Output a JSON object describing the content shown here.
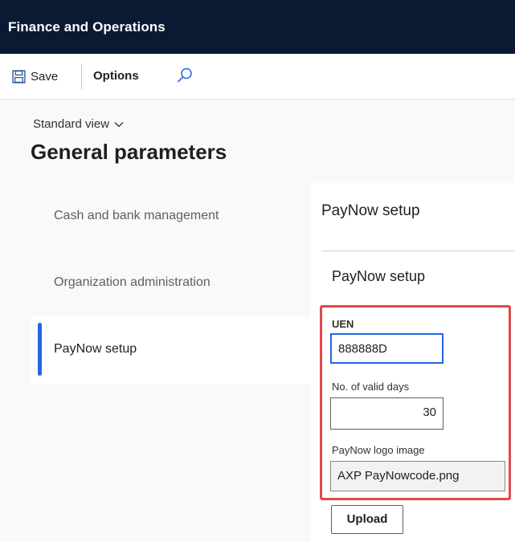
{
  "app": {
    "title": "Finance and Operations"
  },
  "toolbar": {
    "save_label": "Save",
    "options_label": "Options",
    "save_icon": "save-icon",
    "search_icon": "search-icon"
  },
  "header": {
    "view_label": "Standard view",
    "page_title": "General parameters"
  },
  "nav": {
    "items": [
      {
        "label": "Cash and bank management",
        "selected": false
      },
      {
        "label": "Organization administration",
        "selected": false
      },
      {
        "label": "PayNow setup",
        "selected": true
      }
    ]
  },
  "panel": {
    "title": "PayNow setup",
    "section_title": "PayNow setup",
    "fields": {
      "uen": {
        "label": "UEN",
        "value": "888888D"
      },
      "valid_days": {
        "label": "No. of valid days",
        "value": "30"
      },
      "logo": {
        "label": "PayNow logo image",
        "value": "AXP PayNowcode.png"
      }
    },
    "upload_label": "Upload"
  },
  "colors": {
    "appbar": "#0b1a33",
    "accent": "#2266e3",
    "highlight": "#e04a4a"
  }
}
